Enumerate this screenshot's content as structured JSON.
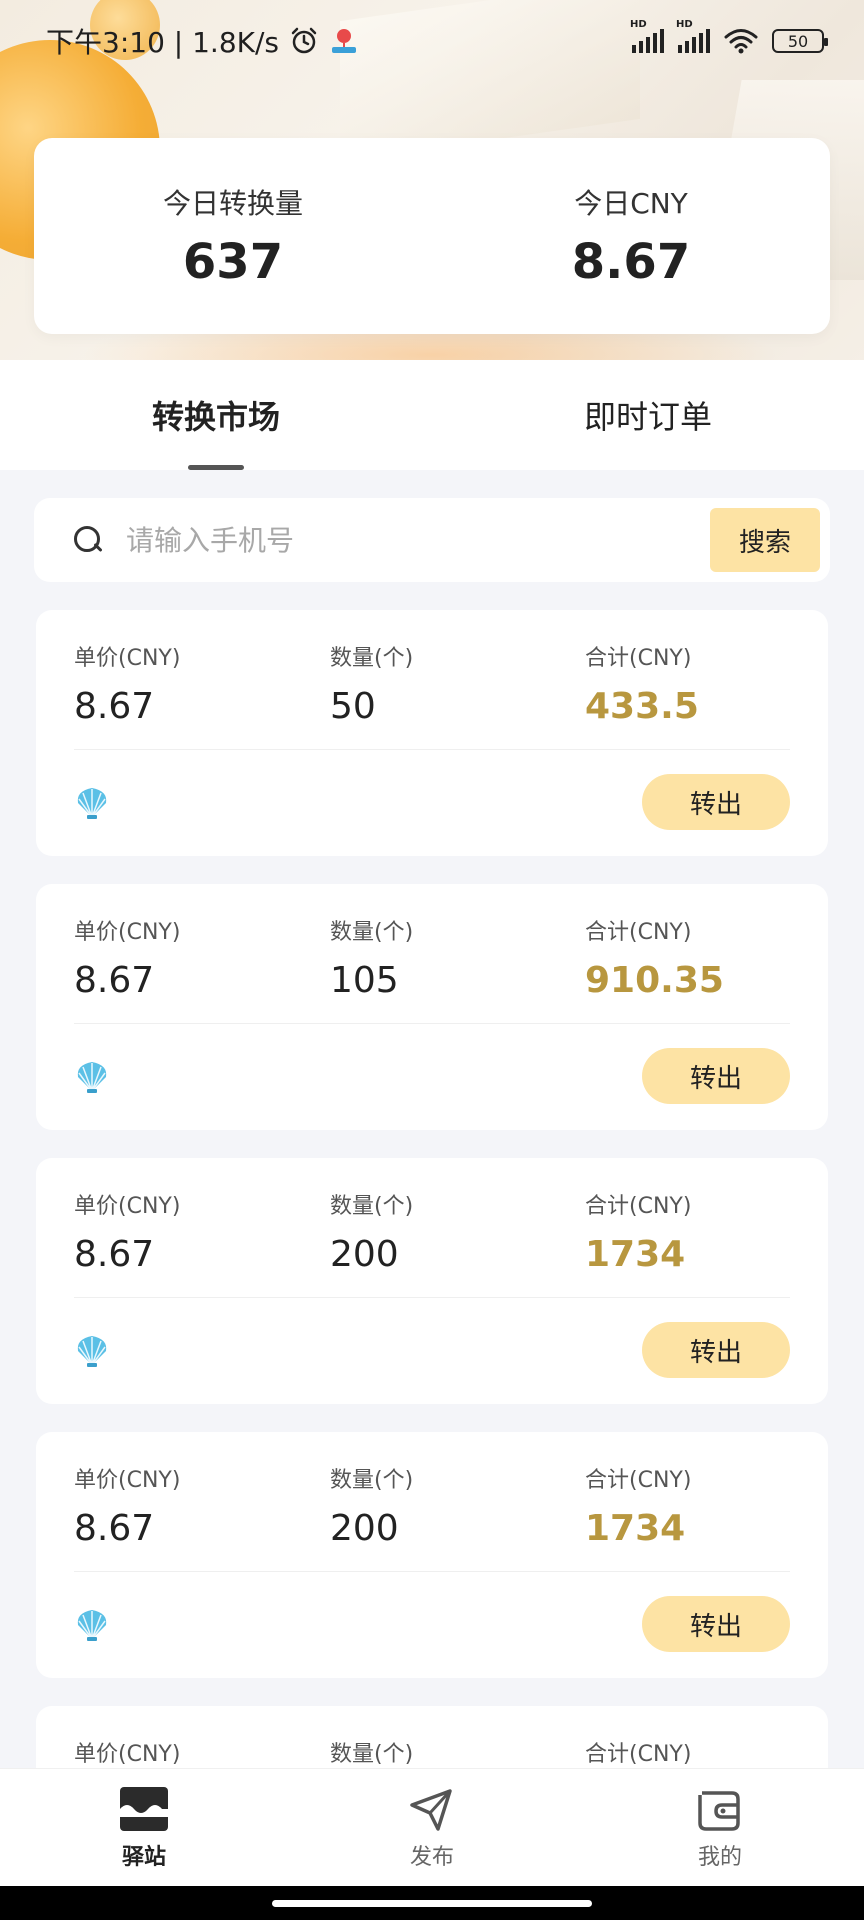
{
  "status_bar": {
    "time": "下午3:10 | 1.8K/s",
    "battery": "50"
  },
  "stats": {
    "today_volume_label": "今日转换量",
    "today_volume_value": "637",
    "today_cny_label": "今日CNY",
    "today_cny_value": "8.67"
  },
  "tabs": [
    {
      "label": "转换市场",
      "active": true
    },
    {
      "label": "即时订单",
      "active": false
    }
  ],
  "search": {
    "placeholder": "请输入手机号",
    "button_label": "搜索"
  },
  "order_labels": {
    "unit_price": "单价(CNY)",
    "quantity": "数量(个)",
    "total": "合计(CNY)",
    "transfer_button": "转出"
  },
  "orders": [
    {
      "unit_price": "8.67",
      "quantity": "50",
      "total": "433.5"
    },
    {
      "unit_price": "8.67",
      "quantity": "105",
      "total": "910.35"
    },
    {
      "unit_price": "8.67",
      "quantity": "200",
      "total": "1734"
    },
    {
      "unit_price": "8.67",
      "quantity": "200",
      "total": "1734"
    }
  ],
  "bottom_nav": [
    {
      "label": "驿站",
      "icon": "station-icon",
      "active": true
    },
    {
      "label": "发布",
      "icon": "send-icon",
      "active": false
    },
    {
      "label": "我的",
      "icon": "wallet-icon",
      "active": false
    }
  ],
  "colors": {
    "accent": "#fde3a4",
    "total_gold": "#b8973f",
    "shell_blue": "#5bc0e6"
  }
}
